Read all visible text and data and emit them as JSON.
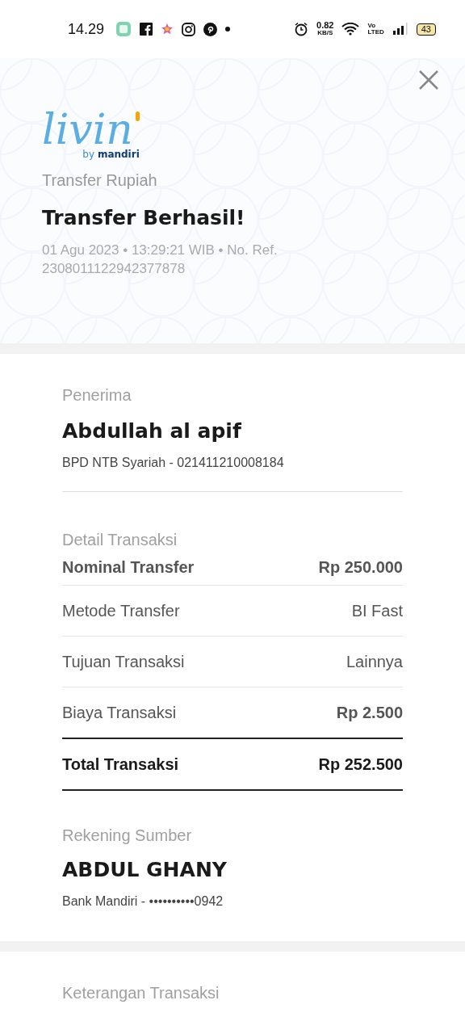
{
  "status_bar": {
    "time": "14.29",
    "speed_value": "0.82",
    "speed_unit": "KB/S",
    "volte_top": "Vo",
    "volte_bottom": "LTED",
    "battery": "43"
  },
  "header": {
    "logo_word": "livin",
    "logo_tag_by": "by",
    "logo_tag_brand": "mandiri",
    "category": "Transfer Rupiah",
    "title": "Transfer Berhasil!",
    "meta": "01 Agu 2023 • 13:29:21 WIB • No. Ref. 2308011122942377878"
  },
  "recipient": {
    "label": "Penerima",
    "name": "Abdullah al apif",
    "account": "BPD NTB Syariah - 021411210008184"
  },
  "details": {
    "label": "Detail Transaksi",
    "rows": [
      {
        "kind": "highlight",
        "label": "Nominal Transfer",
        "value": "Rp 250.000"
      },
      {
        "kind": "plain",
        "label": "Metode Transfer",
        "value": "BI Fast"
      },
      {
        "kind": "plain",
        "label": "Tujuan Transaksi",
        "value": "Lainnya"
      },
      {
        "kind": "fee",
        "label": "Biaya Transaksi",
        "value": "Rp 2.500"
      },
      {
        "kind": "total",
        "label": "Total Transaksi",
        "value": "Rp 252.500"
      }
    ]
  },
  "source": {
    "label": "Rekening Sumber",
    "name": "ABDUL GHANY",
    "account": "Bank Mandiri - ••••••••••0942"
  },
  "notes": {
    "label": "Keterangan Transaksi"
  }
}
